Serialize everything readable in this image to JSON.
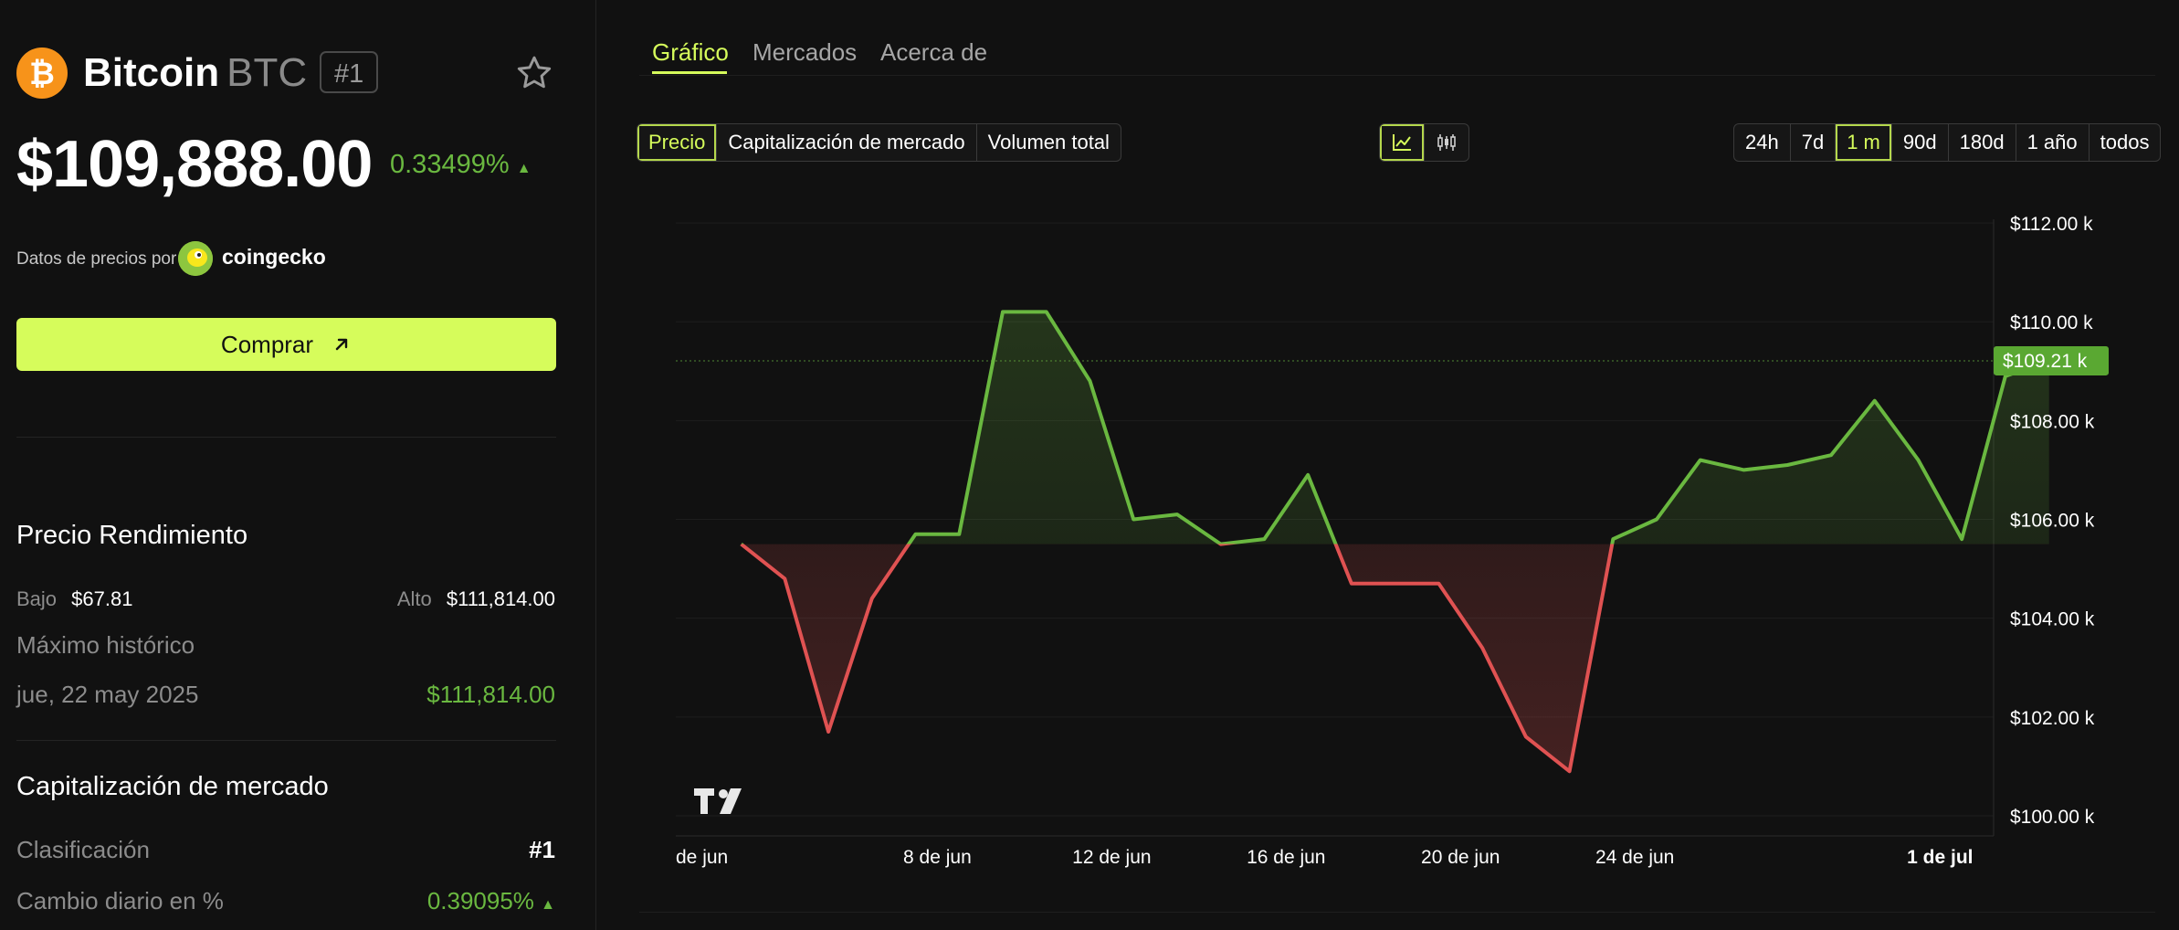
{
  "coin": {
    "name": "Bitcoin",
    "symbol": "BTC",
    "rank_badge": "#1",
    "price": "$109,888.00",
    "change_pct": "0.33499%",
    "change_arrow": "▲",
    "provider_prefix": "Datos de precios por",
    "provider_name": "coingecko",
    "buy_label": "Comprar",
    "icon": "bitcoin-icon"
  },
  "performance": {
    "title": "Precio Rendimiento",
    "low_label": "Bajo",
    "low_value": "$67.81",
    "high_label": "Alto",
    "high_value": "$111,814.00",
    "ath_label": "Máximo histórico",
    "ath_date": "jue, 22 may 2025",
    "ath_value": "$111,814.00"
  },
  "market_cap": {
    "title": "Capitalización de mercado",
    "rank_label": "Clasificación",
    "rank_value": "#1",
    "daily_change_label": "Cambio diario en %",
    "daily_change_value": "0.39095%",
    "daily_change_arrow": "▲"
  },
  "tabs": [
    {
      "label": "Gráfico",
      "active": true
    },
    {
      "label": "Mercados",
      "active": false
    },
    {
      "label": "Acerca de",
      "active": false
    }
  ],
  "metric_buttons": [
    {
      "label": "Precio",
      "active": true
    },
    {
      "label": "Capitalización de mercado",
      "active": false
    },
    {
      "label": "Volumen total",
      "active": false
    }
  ],
  "chart_type_buttons": [
    {
      "icon": "line-chart-icon",
      "active": true
    },
    {
      "icon": "candlestick-icon",
      "active": false
    }
  ],
  "range_buttons": [
    {
      "label": "24h",
      "active": false
    },
    {
      "label": "7d",
      "active": false
    },
    {
      "label": "1 m",
      "active": true
    },
    {
      "label": "90d",
      "active": false
    },
    {
      "label": "180d",
      "active": false
    },
    {
      "label": "1 año",
      "active": false
    },
    {
      "label": "todos",
      "active": false
    }
  ],
  "colors": {
    "accent": "#d6fc5b",
    "up": "#6ab840",
    "down": "#e05252",
    "background": "#111111"
  },
  "chart_data": {
    "type": "area",
    "baseline": 105.5,
    "current_value_label": "$109.21 k",
    "current_value": 109.21,
    "y_ticks": [
      100,
      102,
      104,
      106,
      108,
      110,
      112
    ],
    "y_tick_labels": [
      "$100.00 k",
      "$102.00 k",
      "$104.00 k",
      "$106.00 k",
      "$108.00 k",
      "$110.00 k",
      "$112.00 k"
    ],
    "ylim": [
      99.5,
      113.0
    ],
    "x_tick_labels": [
      {
        "label": "de jun",
        "day": 3.0,
        "bold": false
      },
      {
        "label": "8 de jun",
        "day": 8.0,
        "bold": false
      },
      {
        "label": "12 de jun",
        "day": 12.0,
        "bold": false
      },
      {
        "label": "16 de jun",
        "day": 16.0,
        "bold": false
      },
      {
        "label": "20 de jun",
        "day": 20.0,
        "bold": false
      },
      {
        "label": "24 de jun",
        "day": 24.0,
        "bold": false
      },
      {
        "label": "1 de jul",
        "day": 31.0,
        "bold": true
      }
    ],
    "x": [
      3.5,
      4.5,
      5.5,
      6.5,
      7.5,
      8.5,
      9.5,
      10.5,
      11.5,
      12.5,
      13.5,
      14.5,
      15.5,
      16.5,
      17.5,
      18.5,
      19.5,
      20.5,
      21.5,
      22.5,
      23.5,
      24.5,
      25.5,
      26.5,
      27.5,
      28.5,
      29.5,
      30.5,
      31.5,
      32.5,
      33.5
    ],
    "values": [
      105.5,
      104.8,
      101.7,
      104.4,
      105.7,
      105.7,
      110.2,
      110.2,
      108.8,
      106.0,
      106.1,
      105.5,
      105.6,
      106.9,
      104.7,
      104.7,
      104.7,
      103.4,
      101.6,
      100.9,
      105.6,
      106.0,
      107.2,
      107.0,
      107.1,
      107.3,
      108.4,
      107.2,
      105.6,
      108.9,
      109.21
    ]
  }
}
